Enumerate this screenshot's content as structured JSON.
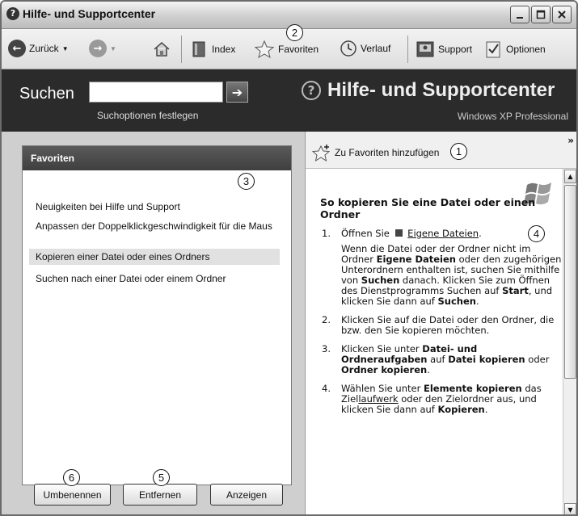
{
  "window": {
    "title": "Hilfe- und Supportcenter"
  },
  "toolbar": {
    "back_label": "Zurück",
    "index_label": "Index",
    "favorites_label": "Favoriten",
    "history_label": "Verlauf",
    "support_label": "Support",
    "options_label": "Optionen"
  },
  "header": {
    "search_label": "Suchen",
    "search_value": "",
    "search_options_link": "Suchoptionen festlegen",
    "brand_title": "Hilfe- und Supportcenter",
    "brand_subtitle": "Windows XP Professional"
  },
  "favorites_panel": {
    "title": "Favoriten",
    "items": [
      "Neuigkeiten bei Hilfe und Support",
      "Anpassen der Doppelklickgeschwindigkeit für die Maus",
      "Kopieren einer Datei oder eines Ordners",
      "Suchen nach einer Datei oder einem Ordner"
    ],
    "selected_index": 2,
    "buttons": {
      "rename": "Umbenennen",
      "remove": "Entfernen",
      "show": "Anzeigen"
    }
  },
  "content": {
    "add_to_favorites": "Zu Favoriten hinzufügen",
    "doc_title": "So kopieren Sie eine Datei oder einen Ordner",
    "step1": {
      "num": "1.",
      "text_before": "Öffnen Sie",
      "link": "Eigene Dateien",
      "text_after": ".",
      "note_1": "Wenn die Datei oder der Ordner nicht im Ordner ",
      "note_bold_1": "Eigene Dateien",
      "note_2": " oder den zugehörigen Unterordnern enthalten ist, suchen Sie mithilfe von ",
      "note_bold_2": "Suchen",
      "note_3": " danach. Klicken Sie zum Öffnen des Dienstprogramms Suchen auf ",
      "note_bold_3": "Start",
      "note_4": ", und klicken Sie dann auf ",
      "note_bold_4": "Suchen",
      "note_5": "."
    },
    "step2": {
      "num": "2.",
      "text": "Klicken Sie auf die Datei oder den Ordner, die bzw. den Sie kopieren möchten."
    },
    "step3": {
      "num": "3.",
      "t1": "Klicken Sie unter ",
      "b1": "Datei- und Ordneraufgaben",
      "t2": " auf ",
      "b2": "Datei kopieren",
      "t3": " oder ",
      "b3": "Ordner kopieren",
      "t4": "."
    },
    "step4": {
      "num": "4.",
      "t1": "Wählen Sie unter ",
      "b1": "Elemente kopieren",
      "t2": " das Ziel",
      "link": "laufwerk",
      "t3": " oder den Zielordner aus, und klicken Sie dann auf ",
      "b2": "Kopieren",
      "t4": "."
    }
  },
  "callouts": [
    "1",
    "2",
    "3",
    "4",
    "5",
    "6"
  ]
}
